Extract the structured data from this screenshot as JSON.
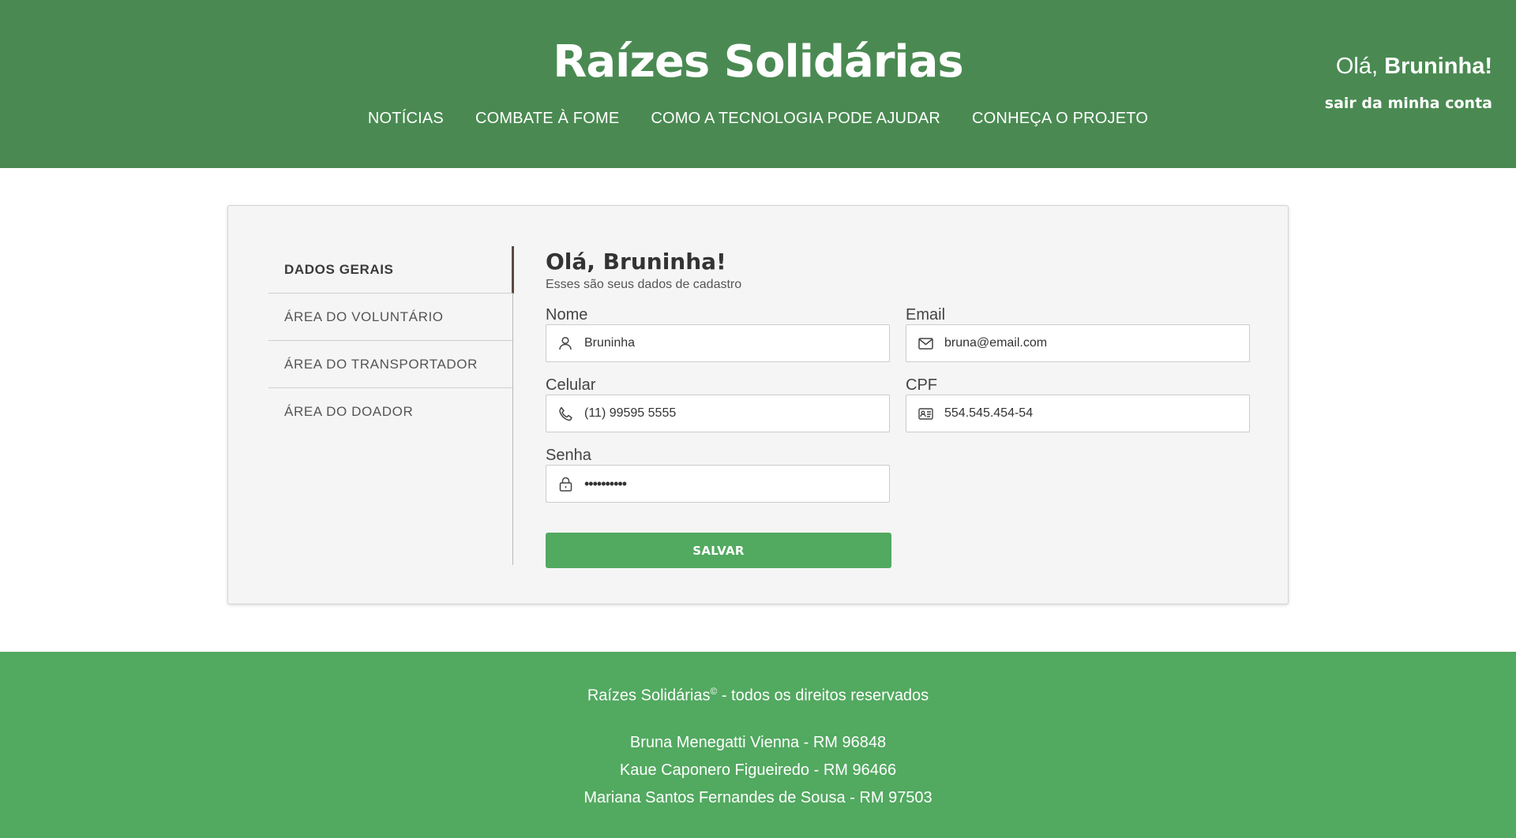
{
  "header": {
    "brand": "Raízes Solidárias",
    "nav": [
      "NOTÍCIAS",
      "COMBATE À FOME",
      "COMO A TECNOLOGIA PODE AJUDAR",
      "CONHEÇA O PROJETO"
    ],
    "greeting_prefix": "Olá,",
    "greeting_name": "Bruninha!",
    "logout": "sair da minha conta"
  },
  "sidemenu": {
    "items": [
      "DADOS GERAIS",
      "ÁREA DO VOLUNTÁRIO",
      "ÁREA DO TRANSPORTADOR",
      "ÁREA DO DOADOR"
    ],
    "active": "DADOS GERAIS"
  },
  "profile": {
    "title": "Olá, Bruninha!",
    "subtitle": "Esses são seus dados de cadastro",
    "fields": {
      "nome": {
        "label": "Nome",
        "value": "Bruninha",
        "icon": "user-icon"
      },
      "email": {
        "label": "Email",
        "value": "bruna@email.com",
        "icon": "envelope-icon"
      },
      "celular": {
        "label": "Celular",
        "value": "(11) 99595 5555",
        "icon": "phone-icon"
      },
      "cpf": {
        "label": "CPF",
        "value": "554.545.454-54",
        "icon": "id-card-icon"
      },
      "senha": {
        "label": "Senha",
        "value": "••••••••••",
        "icon": "lock-icon"
      }
    },
    "save_label": "SALVAR"
  },
  "footer": {
    "brand": "Raízes Solidárias",
    "copyright_mark": "©",
    "rights": " - todos os direitos reservados",
    "authors": [
      "Bruna Menegatti Vienna - RM 96848",
      "Kaue Caponero Figueiredo - RM 96466",
      "Mariana Santos Fernandes de Sousa - RM 97503"
    ]
  },
  "colors": {
    "header_bg": "#4a8a52",
    "footer_bg": "#52a960",
    "button_bg": "#52a960",
    "card_bg": "#f5f5f5"
  }
}
